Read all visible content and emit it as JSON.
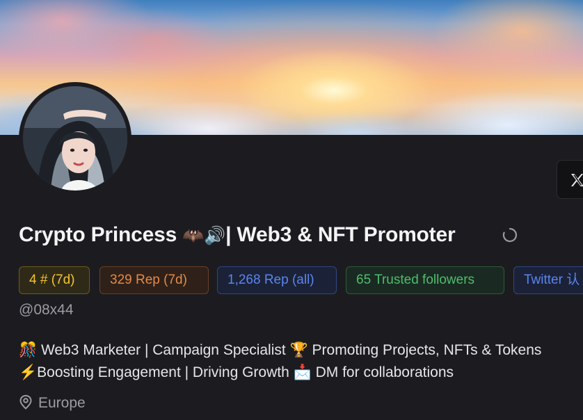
{
  "profile": {
    "display_name": "Crypto Princess",
    "name_emojis": "🦇🔊",
    "name_suffix": "| Web3 & NFT Promoter",
    "handle": "@08x44",
    "bio_line1": "🎊 Web3 Marketer | Campaign Specialist 🏆 Promoting Projects, NFTs & Tokens",
    "bio_line2": "⚡Boosting Engagement | Driving Growth 📩 DM for collaborations",
    "location": "Europe"
  },
  "badges": {
    "rank": "4 # (7d)",
    "rep_7d": "329 Rep (7d)",
    "rep_all": "1,268 Rep (all)",
    "trusted_followers": "65 Trusted followers",
    "twitter": "Twitter 认"
  },
  "colors": {
    "background": "#1c1c20",
    "rank": "#f4c430",
    "rep_7d": "#e48a48",
    "rep_all": "#5a86ee",
    "trusted": "#4fbd6e"
  },
  "icons": [
    "x-logo-icon",
    "loading-spinner-icon",
    "location-pin-icon"
  ]
}
